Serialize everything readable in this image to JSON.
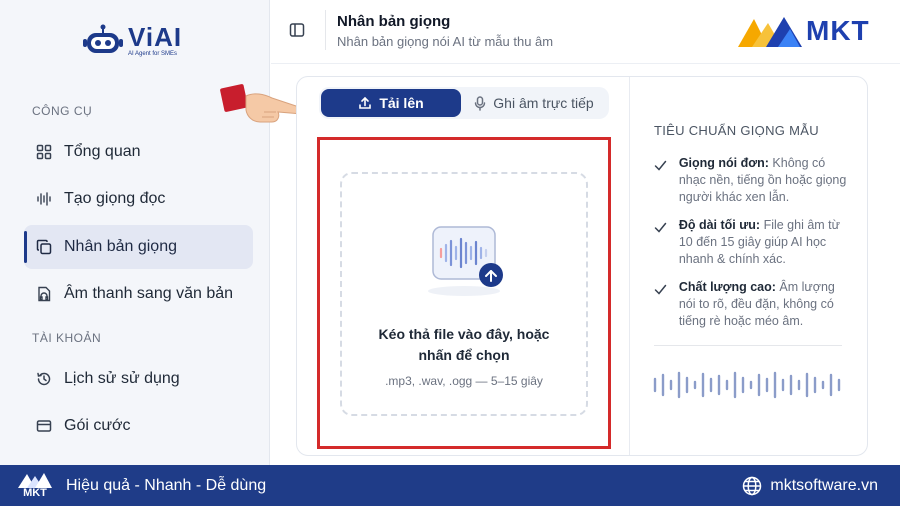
{
  "brand": {
    "name": "ViAI",
    "tagline": "AI Agent for SMEs"
  },
  "sidebar": {
    "tools_label": "CÔNG CỤ",
    "account_label": "TÀI KHOẢN",
    "items": [
      {
        "label": "Tổng quan",
        "icon": "grid-icon"
      },
      {
        "label": "Tạo giọng đọc",
        "icon": "waveform-icon"
      },
      {
        "label": "Nhân bản giọng",
        "icon": "copy-icon",
        "active": true
      },
      {
        "label": "Âm thanh sang văn bản",
        "icon": "audio-file-icon"
      },
      {
        "label": "Lịch sử sử dụng",
        "icon": "history-icon"
      },
      {
        "label": "Gói cước",
        "icon": "card-icon"
      }
    ]
  },
  "header": {
    "title": "Nhân bản giọng",
    "subtitle": "Nhân bản giọng nói AI từ mẫu thu âm",
    "partner_logo": "MKT"
  },
  "tabs": {
    "upload_label": "Tải lên",
    "record_label": "Ghi âm trực tiếp"
  },
  "dropzone": {
    "title": "Kéo thả file vào đây, hoặc nhấn để chọn",
    "hint": ".mp3, .wav, .ogg — 5–15 giây"
  },
  "standards": {
    "title": "TIÊU CHUẨN GIỌNG MẪU",
    "rules": [
      {
        "head": "Giọng nói đơn:",
        "text": " Không có nhạc nền, tiếng ồn hoặc giọng người khác xen lẫn."
      },
      {
        "head": "Độ dài tối ưu:",
        "text": " File ghi âm từ 10 đến 15 giây giúp AI học nhanh & chính xác."
      },
      {
        "head": "Chất lượng cao:",
        "text": " Âm lượng nói to rõ, đều đặn, không có tiếng rè hoặc méo âm."
      }
    ]
  },
  "footer": {
    "logo": "MKT",
    "slogan": "Hiệu quả - Nhanh - Dễ dùng",
    "website": "mktsoftware.vn"
  },
  "colors": {
    "primary": "#1d3a8a",
    "footer": "#1f3c88",
    "highlight_frame": "#d42a2a"
  }
}
